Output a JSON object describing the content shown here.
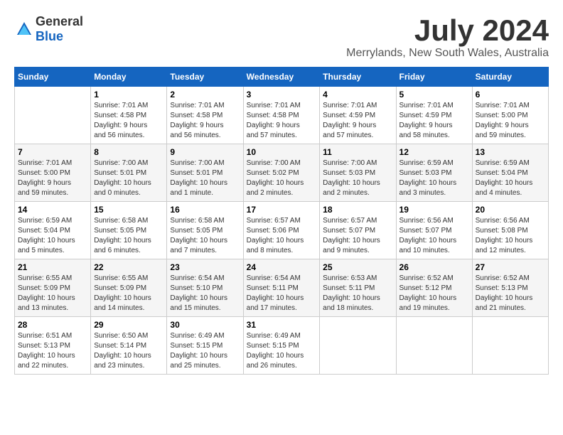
{
  "header": {
    "logo_general": "General",
    "logo_blue": "Blue",
    "month": "July 2024",
    "location": "Merrylands, New South Wales, Australia"
  },
  "columns": [
    "Sunday",
    "Monday",
    "Tuesday",
    "Wednesday",
    "Thursday",
    "Friday",
    "Saturday"
  ],
  "weeks": [
    [
      {
        "num": "",
        "info": ""
      },
      {
        "num": "1",
        "info": "Sunrise: 7:01 AM\nSunset: 4:58 PM\nDaylight: 9 hours\nand 56 minutes."
      },
      {
        "num": "2",
        "info": "Sunrise: 7:01 AM\nSunset: 4:58 PM\nDaylight: 9 hours\nand 56 minutes."
      },
      {
        "num": "3",
        "info": "Sunrise: 7:01 AM\nSunset: 4:58 PM\nDaylight: 9 hours\nand 57 minutes."
      },
      {
        "num": "4",
        "info": "Sunrise: 7:01 AM\nSunset: 4:59 PM\nDaylight: 9 hours\nand 57 minutes."
      },
      {
        "num": "5",
        "info": "Sunrise: 7:01 AM\nSunset: 4:59 PM\nDaylight: 9 hours\nand 58 minutes."
      },
      {
        "num": "6",
        "info": "Sunrise: 7:01 AM\nSunset: 5:00 PM\nDaylight: 9 hours\nand 59 minutes."
      }
    ],
    [
      {
        "num": "7",
        "info": "Sunrise: 7:01 AM\nSunset: 5:00 PM\nDaylight: 9 hours\nand 59 minutes."
      },
      {
        "num": "8",
        "info": "Sunrise: 7:00 AM\nSunset: 5:01 PM\nDaylight: 10 hours\nand 0 minutes."
      },
      {
        "num": "9",
        "info": "Sunrise: 7:00 AM\nSunset: 5:01 PM\nDaylight: 10 hours\nand 1 minute."
      },
      {
        "num": "10",
        "info": "Sunrise: 7:00 AM\nSunset: 5:02 PM\nDaylight: 10 hours\nand 2 minutes."
      },
      {
        "num": "11",
        "info": "Sunrise: 7:00 AM\nSunset: 5:03 PM\nDaylight: 10 hours\nand 2 minutes."
      },
      {
        "num": "12",
        "info": "Sunrise: 6:59 AM\nSunset: 5:03 PM\nDaylight: 10 hours\nand 3 minutes."
      },
      {
        "num": "13",
        "info": "Sunrise: 6:59 AM\nSunset: 5:04 PM\nDaylight: 10 hours\nand 4 minutes."
      }
    ],
    [
      {
        "num": "14",
        "info": "Sunrise: 6:59 AM\nSunset: 5:04 PM\nDaylight: 10 hours\nand 5 minutes."
      },
      {
        "num": "15",
        "info": "Sunrise: 6:58 AM\nSunset: 5:05 PM\nDaylight: 10 hours\nand 6 minutes."
      },
      {
        "num": "16",
        "info": "Sunrise: 6:58 AM\nSunset: 5:05 PM\nDaylight: 10 hours\nand 7 minutes."
      },
      {
        "num": "17",
        "info": "Sunrise: 6:57 AM\nSunset: 5:06 PM\nDaylight: 10 hours\nand 8 minutes."
      },
      {
        "num": "18",
        "info": "Sunrise: 6:57 AM\nSunset: 5:07 PM\nDaylight: 10 hours\nand 9 minutes."
      },
      {
        "num": "19",
        "info": "Sunrise: 6:56 AM\nSunset: 5:07 PM\nDaylight: 10 hours\nand 10 minutes."
      },
      {
        "num": "20",
        "info": "Sunrise: 6:56 AM\nSunset: 5:08 PM\nDaylight: 10 hours\nand 12 minutes."
      }
    ],
    [
      {
        "num": "21",
        "info": "Sunrise: 6:55 AM\nSunset: 5:09 PM\nDaylight: 10 hours\nand 13 minutes."
      },
      {
        "num": "22",
        "info": "Sunrise: 6:55 AM\nSunset: 5:09 PM\nDaylight: 10 hours\nand 14 minutes."
      },
      {
        "num": "23",
        "info": "Sunrise: 6:54 AM\nSunset: 5:10 PM\nDaylight: 10 hours\nand 15 minutes."
      },
      {
        "num": "24",
        "info": "Sunrise: 6:54 AM\nSunset: 5:11 PM\nDaylight: 10 hours\nand 17 minutes."
      },
      {
        "num": "25",
        "info": "Sunrise: 6:53 AM\nSunset: 5:11 PM\nDaylight: 10 hours\nand 18 minutes."
      },
      {
        "num": "26",
        "info": "Sunrise: 6:52 AM\nSunset: 5:12 PM\nDaylight: 10 hours\nand 19 minutes."
      },
      {
        "num": "27",
        "info": "Sunrise: 6:52 AM\nSunset: 5:13 PM\nDaylight: 10 hours\nand 21 minutes."
      }
    ],
    [
      {
        "num": "28",
        "info": "Sunrise: 6:51 AM\nSunset: 5:13 PM\nDaylight: 10 hours\nand 22 minutes."
      },
      {
        "num": "29",
        "info": "Sunrise: 6:50 AM\nSunset: 5:14 PM\nDaylight: 10 hours\nand 23 minutes."
      },
      {
        "num": "30",
        "info": "Sunrise: 6:49 AM\nSunset: 5:15 PM\nDaylight: 10 hours\nand 25 minutes."
      },
      {
        "num": "31",
        "info": "Sunrise: 6:49 AM\nSunset: 5:15 PM\nDaylight: 10 hours\nand 26 minutes."
      },
      {
        "num": "",
        "info": ""
      },
      {
        "num": "",
        "info": ""
      },
      {
        "num": "",
        "info": ""
      }
    ]
  ]
}
